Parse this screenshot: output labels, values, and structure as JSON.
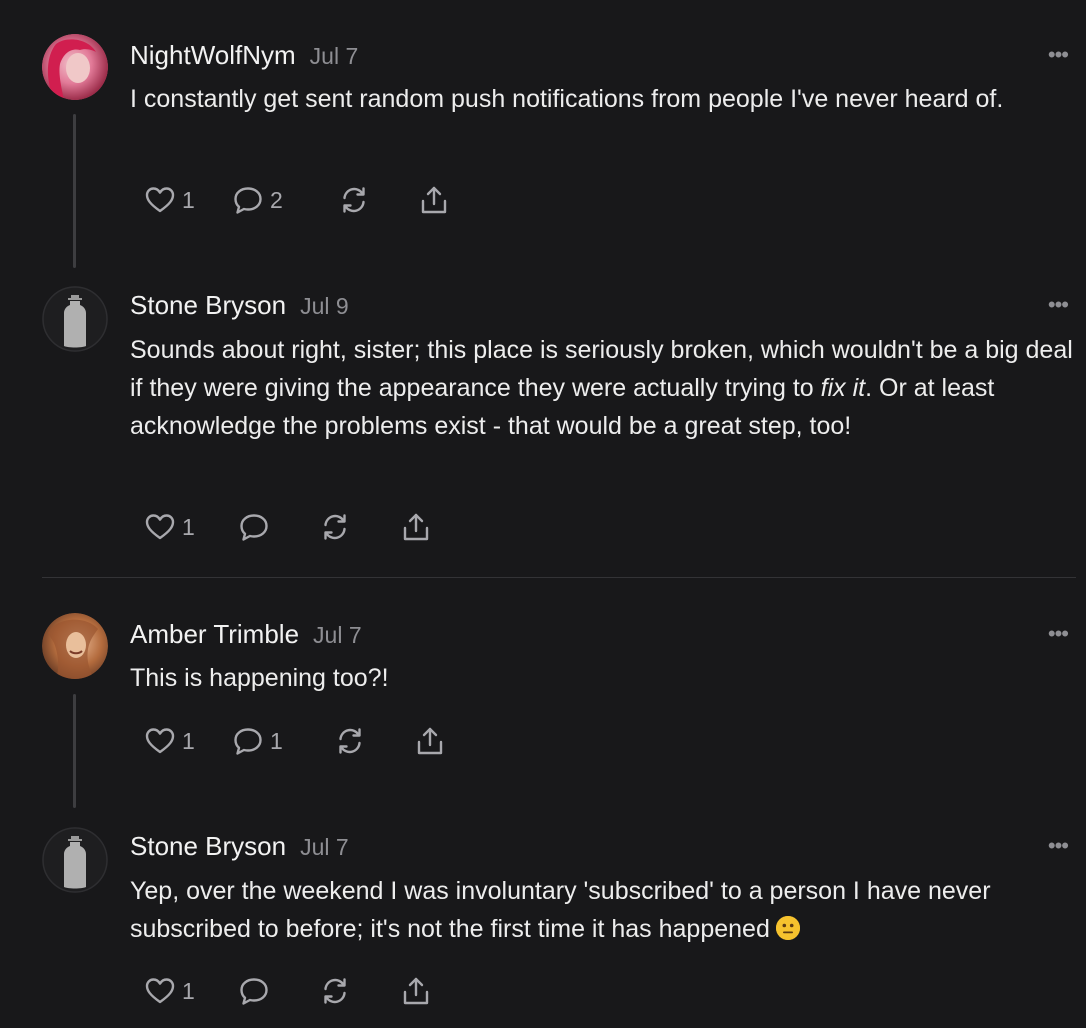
{
  "comments": [
    {
      "author": "NightWolfNym",
      "date": "Jul 7",
      "text": "I constantly get sent random push notifications from people I've never heard of.",
      "likes": "1",
      "replies": "2"
    },
    {
      "author": "Stone Bryson",
      "date": "Jul 9",
      "text_part1": "Sounds about right, sister; this place is seriously broken, which wouldn't be a big deal if they were giving the appearance they were actually trying to ",
      "text_italic": "fix it",
      "text_part2": ". Or at least acknowledge the problems exist - that would be a great step, too!",
      "likes": "1",
      "replies": ""
    },
    {
      "author": "Amber Trimble",
      "date": "Jul 7",
      "text": "This is happening too?!",
      "likes": "1",
      "replies": "1"
    },
    {
      "author": "Stone Bryson",
      "date": "Jul 7",
      "text": "Yep, over the weekend I was involuntary 'subscribed' to a person I have never subscribed to before; it's not the first time it has happened",
      "emoji": "neutral-face-emoji",
      "likes": "1",
      "replies": ""
    }
  ],
  "more_label": "•••",
  "icons": {
    "like": "heart-icon",
    "reply": "speech-bubble-icon",
    "restack": "restack-icon",
    "share": "share-icon"
  },
  "colors": {
    "background": "#18181a",
    "text": "#ededed",
    "muted": "#8e8e93",
    "thread_line": "#3d3d40"
  }
}
